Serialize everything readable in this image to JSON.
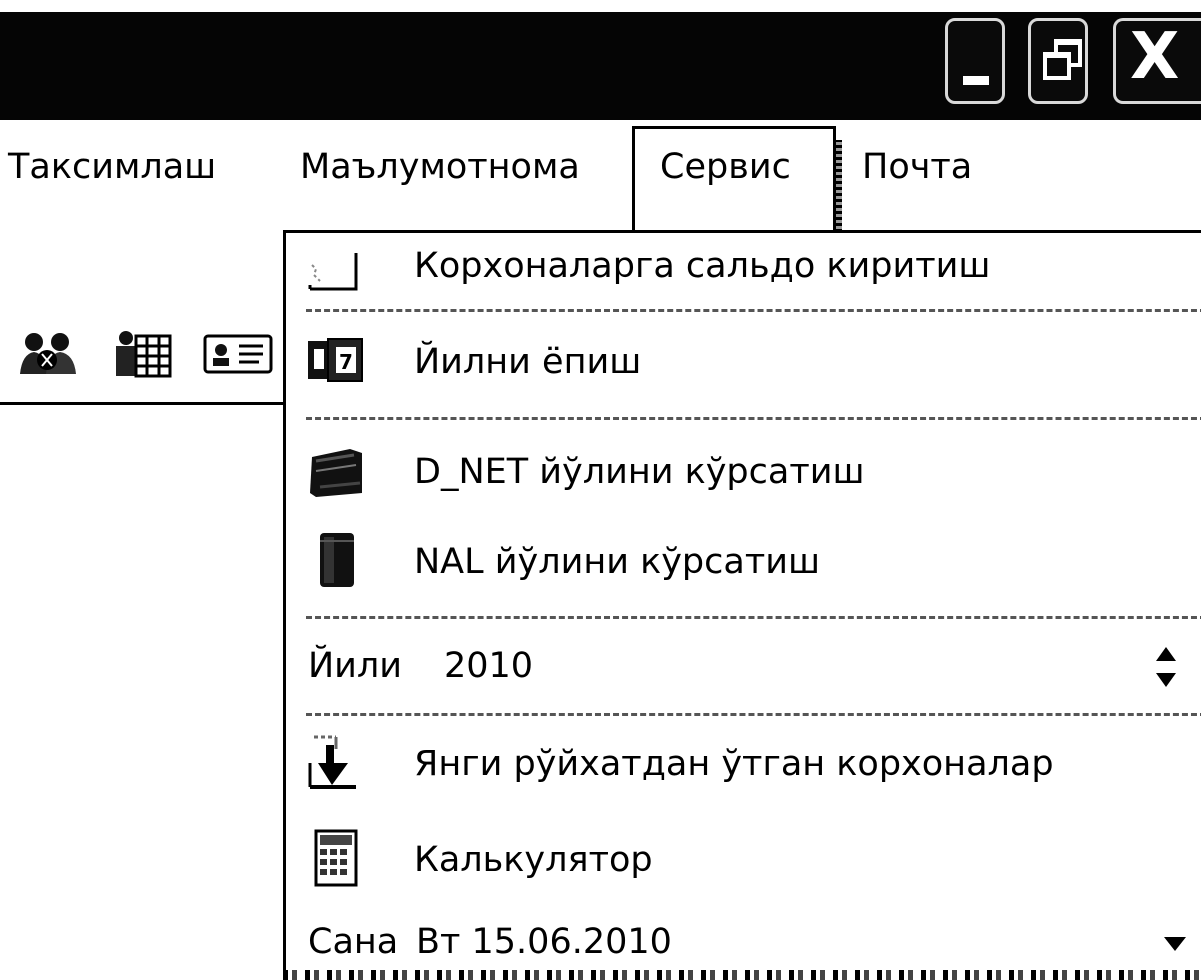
{
  "window": {
    "minimize_icon": "minimize-icon",
    "restore_icon": "restore-icon",
    "close_icon": "close-icon",
    "close_glyph": "X"
  },
  "menubar": {
    "items": [
      {
        "label": "Таксимлаш"
      },
      {
        "label": "Маълумотнома"
      },
      {
        "label": "Сервис",
        "active": true
      },
      {
        "label": "Почта"
      }
    ]
  },
  "toolbar": {
    "icons": [
      "users-icon",
      "organization-chart-icon",
      "id-card-icon"
    ]
  },
  "service_menu": {
    "items": [
      {
        "label": "Корхоналарга сальдо киритиш",
        "icon": "document-icon"
      },
      {
        "label": "Йилни ёпиш",
        "icon": "calendar-icon"
      },
      {
        "label": "D_NET йўлини кўрсатиш",
        "icon": "network-folder-icon"
      },
      {
        "label": "NAL йўлини кўрсатиш",
        "icon": "database-icon"
      },
      {
        "label": "Янги рўйхатдан ўтган корхоналар",
        "icon": "download-document-icon"
      },
      {
        "label": "Калькулятор",
        "icon": "calculator-icon"
      }
    ],
    "year": {
      "label": "Йили",
      "value": "2010"
    },
    "date": {
      "label": "Сана",
      "value": "Вт 15.06.2010"
    }
  }
}
